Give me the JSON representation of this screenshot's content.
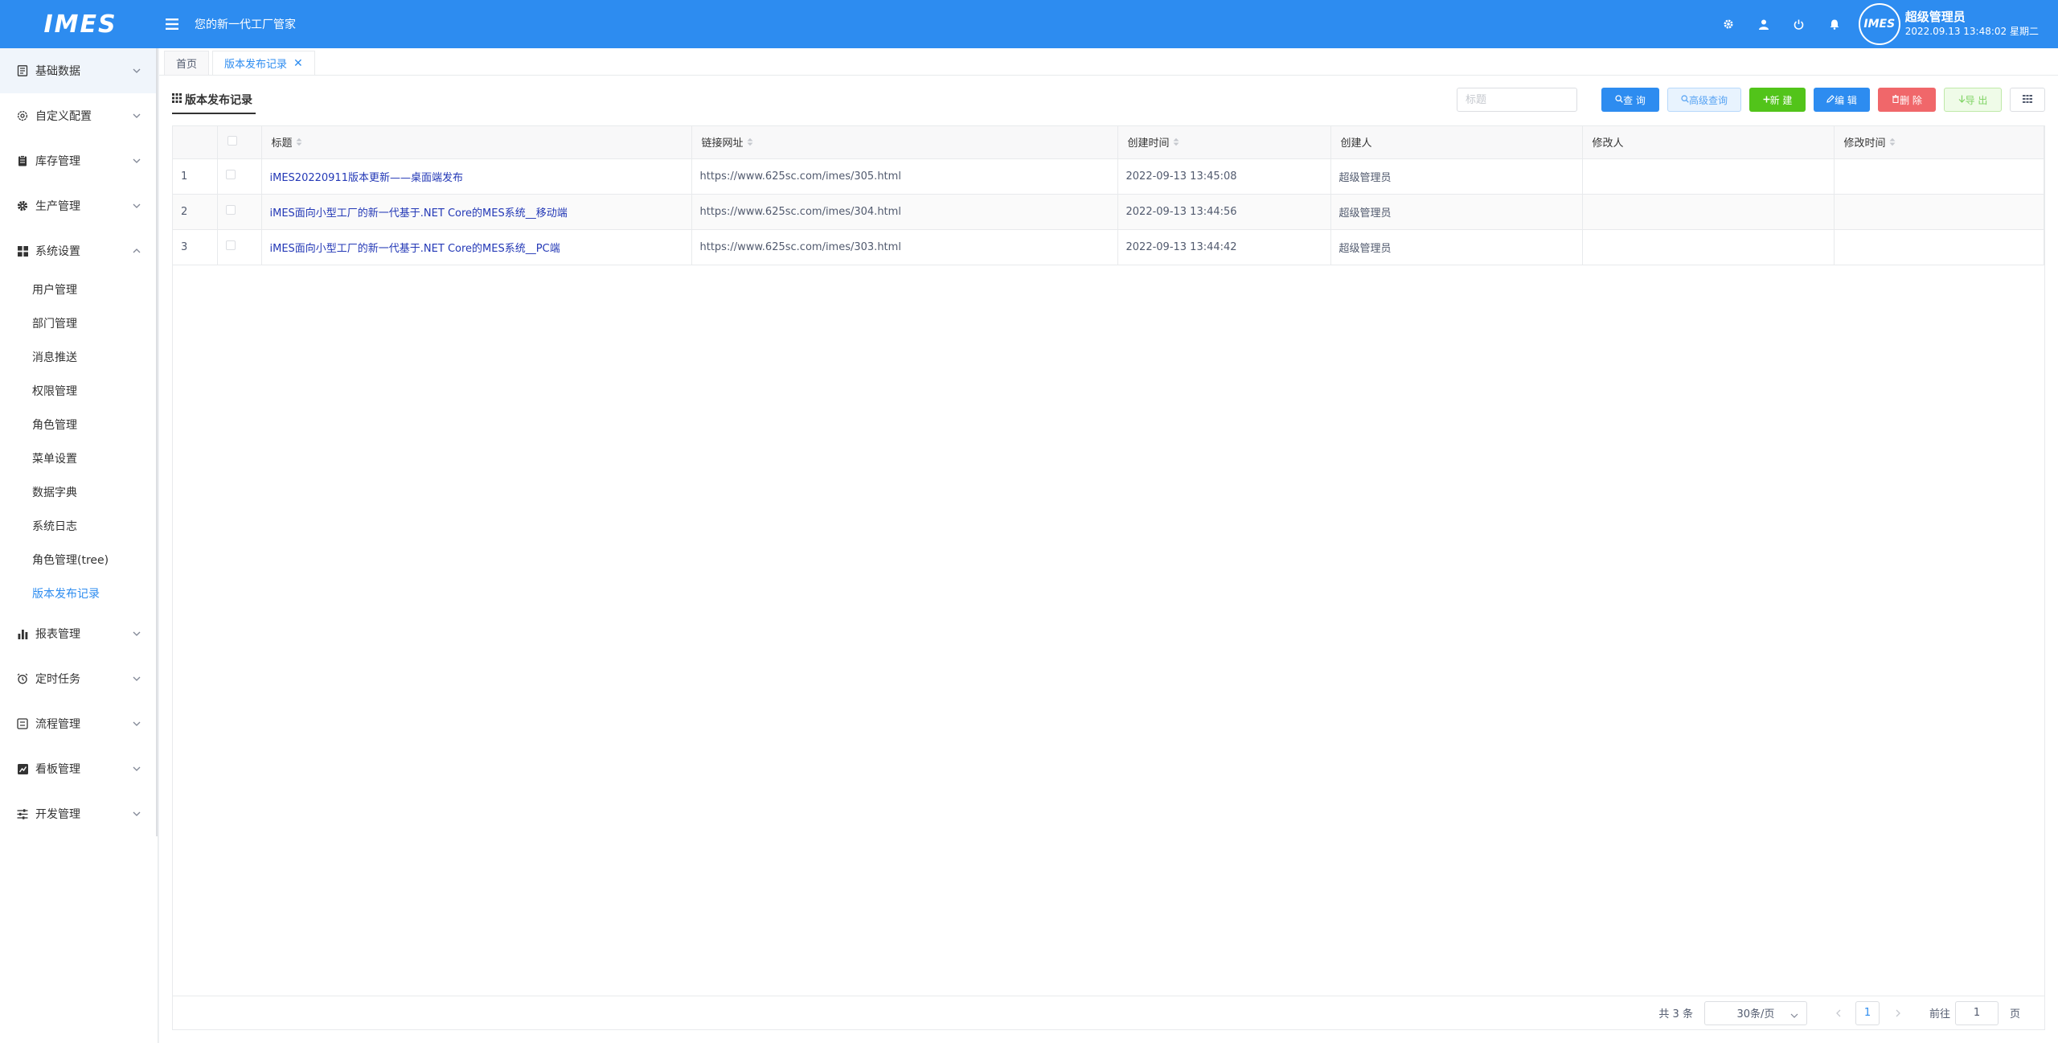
{
  "header": {
    "logo": "IMES",
    "slogan": "您的新一代工厂管家",
    "avatar_text": "IMES",
    "user_name": "超级管理员",
    "datetime": "2022.09.13 13:48:02 星期二"
  },
  "sidebar": {
    "groups_top": [
      {
        "label": "基础数据",
        "icon": "document-icon"
      },
      {
        "label": "自定义配置",
        "icon": "gear-outline-icon"
      },
      {
        "label": "库存管理",
        "icon": "clipboard-icon"
      },
      {
        "label": "生产管理",
        "icon": "gear-icon"
      },
      {
        "label": "系统设置",
        "icon": "grid-icon"
      }
    ],
    "subitems": [
      {
        "label": "用户管理"
      },
      {
        "label": "部门管理"
      },
      {
        "label": "消息推送"
      },
      {
        "label": "权限管理"
      },
      {
        "label": "角色管理"
      },
      {
        "label": "菜单设置"
      },
      {
        "label": "数据字典"
      },
      {
        "label": "系统日志"
      },
      {
        "label": "角色管理(tree)"
      },
      {
        "label": "版本发布记录"
      }
    ],
    "groups_bottom": [
      {
        "label": "报表管理",
        "icon": "bar-chart-icon"
      },
      {
        "label": "定时任务",
        "icon": "alarm-icon"
      },
      {
        "label": "流程管理",
        "icon": "flow-icon"
      },
      {
        "label": "看板管理",
        "icon": "trend-icon"
      },
      {
        "label": "开发管理",
        "icon": "sliders-icon"
      }
    ]
  },
  "tabs": [
    {
      "label": "首页"
    },
    {
      "label": "版本发布记录",
      "close": "✕"
    }
  ],
  "toolbar": {
    "title": "版本发布记录",
    "search_placeholder": "标题",
    "query": "查 询",
    "advanced_query": "高级查询",
    "new": "新 建",
    "edit": "编 辑",
    "delete": "删 除",
    "export": "导 出"
  },
  "table": {
    "columns": [
      "标题",
      "链接网址",
      "创建时间",
      "创建人",
      "修改人",
      "修改时间"
    ],
    "rows": [
      {
        "index": "1",
        "title": "iMES20220911版本更新——桌面端发布",
        "url": "https://www.625sc.com/imes/305.html",
        "created": "2022-09-13 13:45:08",
        "creator": "超级管理员",
        "modifier": "",
        "modified": ""
      },
      {
        "index": "2",
        "title": "iMES面向小型工厂的新一代基于.NET Core的MES系统__移动端",
        "url": "https://www.625sc.com/imes/304.html",
        "created": "2022-09-13 13:44:56",
        "creator": "超级管理员",
        "modifier": "",
        "modified": ""
      },
      {
        "index": "3",
        "title": "iMES面向小型工厂的新一代基于.NET Core的MES系统__PC端",
        "url": "https://www.625sc.com/imes/303.html",
        "created": "2022-09-13 13:44:42",
        "creator": "超级管理员",
        "modifier": "",
        "modified": ""
      }
    ]
  },
  "pager": {
    "total": "共 3 条",
    "page_size": "30条/页",
    "current_page": "1",
    "jump_label": "前往",
    "jump_value": "1",
    "page_suffix": "页"
  },
  "colors": {
    "primary": "#2d8cf0",
    "success": "#52c41a",
    "danger": "#f0676a"
  }
}
